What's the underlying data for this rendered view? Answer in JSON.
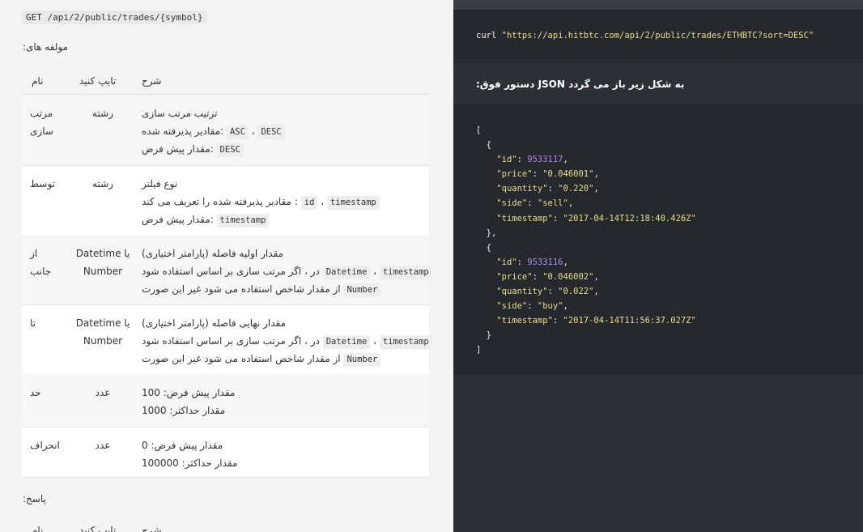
{
  "left": {
    "endpoint": "GET /api/2/public/trades/{symbol}",
    "params_heading": "مولفه های:",
    "table": {
      "headers": {
        "name": "نام",
        "type": "تایپ کنید",
        "desc": "شرح"
      },
      "rows": [
        {
          "name": "مرتب سازی",
          "type": "رشته",
          "desc": [
            {
              "text": "ترتیب مرتب سازی",
              "codes": []
            },
            {
              "text": "مقادیر پذیرفته شده:",
              "codes": [
                "ASC",
                "DESC"
              ]
            },
            {
              "text": "مقدار پیش فرض:",
              "codes": [
                "DESC"
              ]
            }
          ]
        },
        {
          "name": "توسط",
          "type": "رشته",
          "desc": [
            {
              "text": "نوع فیلتر",
              "codes": []
            },
            {
              "text": "مقادیر پذیرفته شده را تعریف می کند :",
              "codes": [
                "id",
                "timestamp"
              ]
            },
            {
              "text": "مقدار پیش فرض:",
              "codes": [
                "timestamp"
              ]
            }
          ]
        },
        {
          "name": "از جانب",
          "type": "Datetime یا Number",
          "desc": [
            {
              "text": "مقدار اولیه فاصله (پارامتر اختیاری)",
              "codes": []
            },
            {
              "text": "در ، اگر مرتب سازی بر اساس استفاده شود",
              "codes": [
                "Datetime",
                "timestamp"
              ]
            },
            {
              "text": "از مقدار شاخص استفاده می شود غیر این صورت",
              "codes": [
                "Number"
              ]
            }
          ]
        },
        {
          "name": "تا",
          "type": "Datetime یا Number",
          "desc": [
            {
              "text": "مقدار نهایی فاصله (پارامتر اختیاری)",
              "codes": []
            },
            {
              "text": "در ، اگر مرتب سازی بر اساس استفاده شود",
              "codes": [
                "Datetime",
                "timestamp"
              ]
            },
            {
              "text": "از مقدار شاخص استفاده می شود غیر این صورت",
              "codes": [
                "Number"
              ]
            }
          ]
        },
        {
          "name": "حد",
          "type": "عدد",
          "desc": [
            {
              "text": "مقدار پیش فرض: 100",
              "codes": []
            },
            {
              "text": "مقدار حداکثر: 1000",
              "codes": []
            }
          ]
        },
        {
          "name": "انحراف",
          "type": "عدد",
          "desc": [
            {
              "text": "مقدار پیش فرض: 0",
              "codes": []
            },
            {
              "text": "مقدار حداکثر: 100000",
              "codes": []
            }
          ]
        }
      ]
    },
    "response_heading": "پاسخ:",
    "response_table_headers": {
      "name": "نام",
      "type": "تایپ کنید",
      "desc": "شرح"
    }
  },
  "right": {
    "curl_cmd": "curl",
    "curl_url": "\"https://api.hitbtc.com/api/2/public/trades/ETHBTC?sort=DESC\"",
    "response_desc": "به شکل زیر باز می گردد JSON دستور فوق:",
    "json": [
      {
        "id": 9533117,
        "price": "0.046001",
        "quantity": "0.220",
        "side": "sell",
        "timestamp": "2017-04-14T12:18:40.426Z"
      },
      {
        "id": 9533116,
        "price": "0.046002",
        "quantity": "0.022",
        "side": "buy",
        "timestamp": "2017-04-14T11:56:37.027Z"
      }
    ]
  },
  "colors": {
    "code_background": "#25282c",
    "json_key": "#e8dd8c",
    "json_number": "#ae8bf0"
  }
}
